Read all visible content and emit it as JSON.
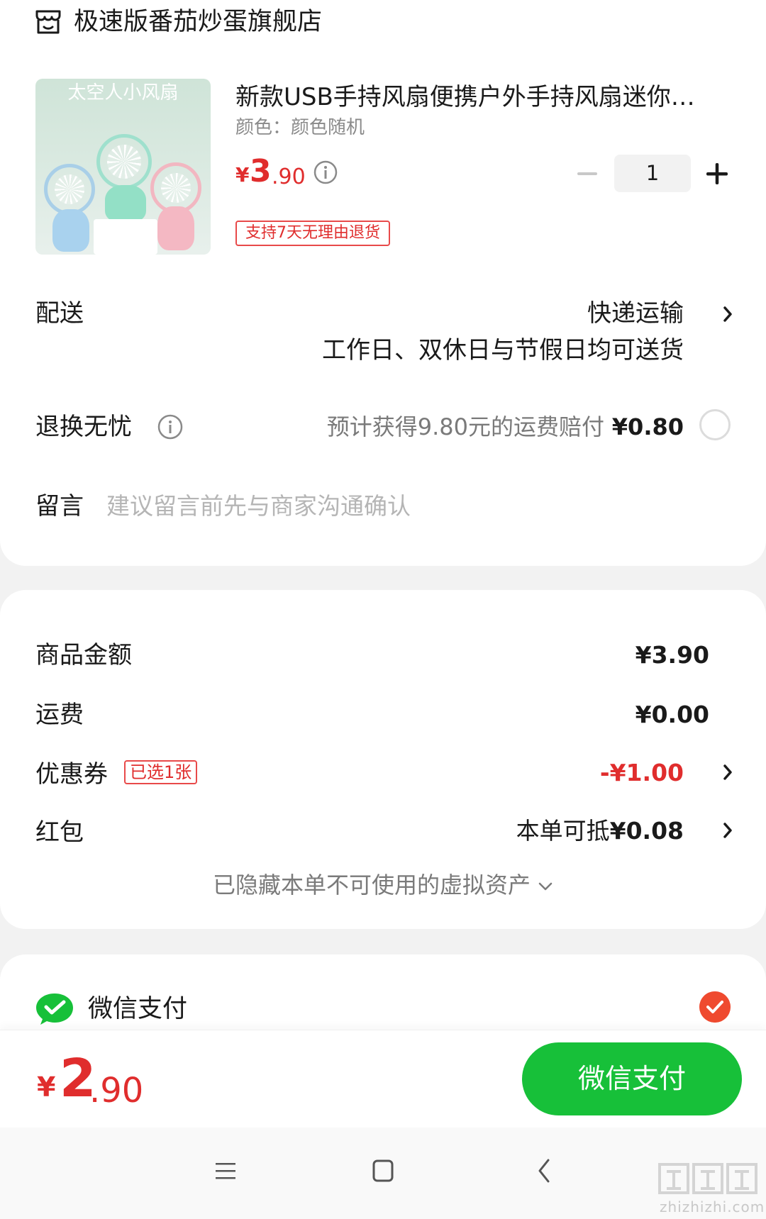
{
  "store": {
    "name": "极速版番茄炒蛋旗舰店",
    "icon": "store-icon"
  },
  "product": {
    "image_banner": "太空人小风扇",
    "title": "新款USB手持风扇便携户外手持风扇迷你…",
    "variant": "颜色：颜色随机",
    "price_symbol": "¥",
    "price_int": "3",
    "price_dec": ".90",
    "quantity": "1",
    "return_tag": "支持7天无理由退货"
  },
  "delivery": {
    "label": "配送",
    "method": "快递运输",
    "note": "工作日、双休日与节假日均可送货"
  },
  "worry_free": {
    "label": "退换无忧",
    "text": "预计获得9.80元的运费赔付",
    "price": "¥0.80"
  },
  "message": {
    "label": "留言",
    "placeholder": "建议留言前先与商家沟通确认"
  },
  "summary": {
    "goods_label": "商品金额",
    "goods_value": "¥3.90",
    "shipping_label": "运费",
    "shipping_value": "¥0.00",
    "coupon_label": "优惠券",
    "coupon_tag": "已选1张",
    "coupon_value": "-¥1.00",
    "red_packet_label": "红包",
    "red_packet_prefix": "本单可抵",
    "red_packet_value": "¥0.08",
    "hidden_assets": "已隐藏本单不可使用的虚拟资产"
  },
  "payment": {
    "method_label": "微信支付",
    "selected": true
  },
  "checkout": {
    "total_symbol": "¥",
    "total_int": "2",
    "total_dec": ".90",
    "button_label": "微信支付"
  },
  "watermark": {
    "text": "zhizhizhi.com"
  },
  "colors": {
    "accent_red": "#e02d2d",
    "wechat_green": "#17c039",
    "check_orange": "#ef4a2f"
  }
}
